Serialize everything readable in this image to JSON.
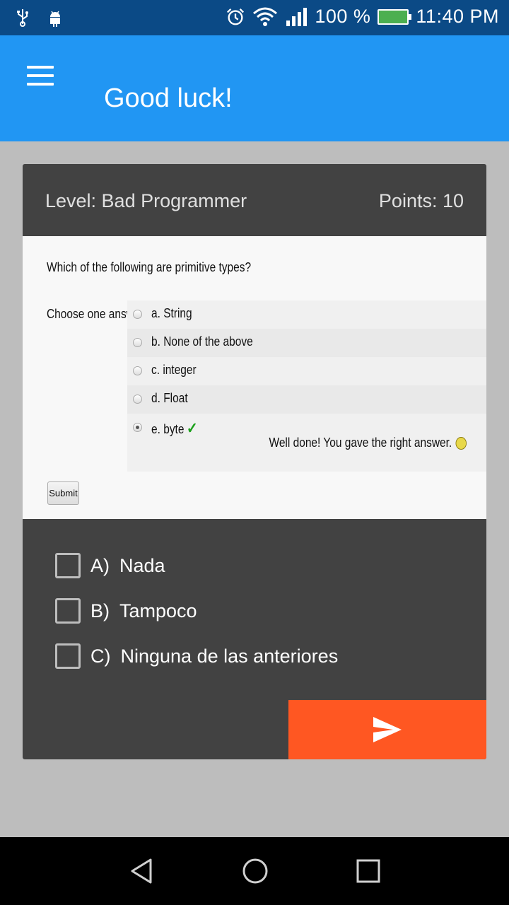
{
  "status_bar": {
    "icons_left": [
      "usb-icon",
      "android-icon"
    ],
    "icons_right": [
      "alarm-icon",
      "wifi-icon",
      "signal-icon"
    ],
    "battery_percent": "100 %",
    "time": "11:40 PM"
  },
  "app_bar": {
    "title": "Good luck!"
  },
  "card": {
    "level": "Level: Bad Programmer",
    "points": "Points: 10"
  },
  "question_image": {
    "question": "Which of the following are primitive types?",
    "choose_label": "Choose one answer.",
    "options": [
      {
        "label": "a. String",
        "checked": false
      },
      {
        "label": "b. None of the above",
        "checked": false
      },
      {
        "label": "c. integer",
        "checked": false
      },
      {
        "label": "d. Float",
        "checked": false
      },
      {
        "label": "e. byte",
        "checked": true
      }
    ],
    "feedback": "Well done! You gave the right answer.",
    "submit_label": "Submit"
  },
  "answers": [
    {
      "letter": "A)",
      "text": "Nada"
    },
    {
      "letter": "B)",
      "text": "Tampoco"
    },
    {
      "letter": "C)",
      "text": "Ninguna de las anteriores"
    }
  ],
  "colors": {
    "status_bar": "#0b4a86",
    "app_bar": "#2196f3",
    "card": "#424242",
    "send_button": "#ff5722",
    "background": "#bdbdbd"
  }
}
